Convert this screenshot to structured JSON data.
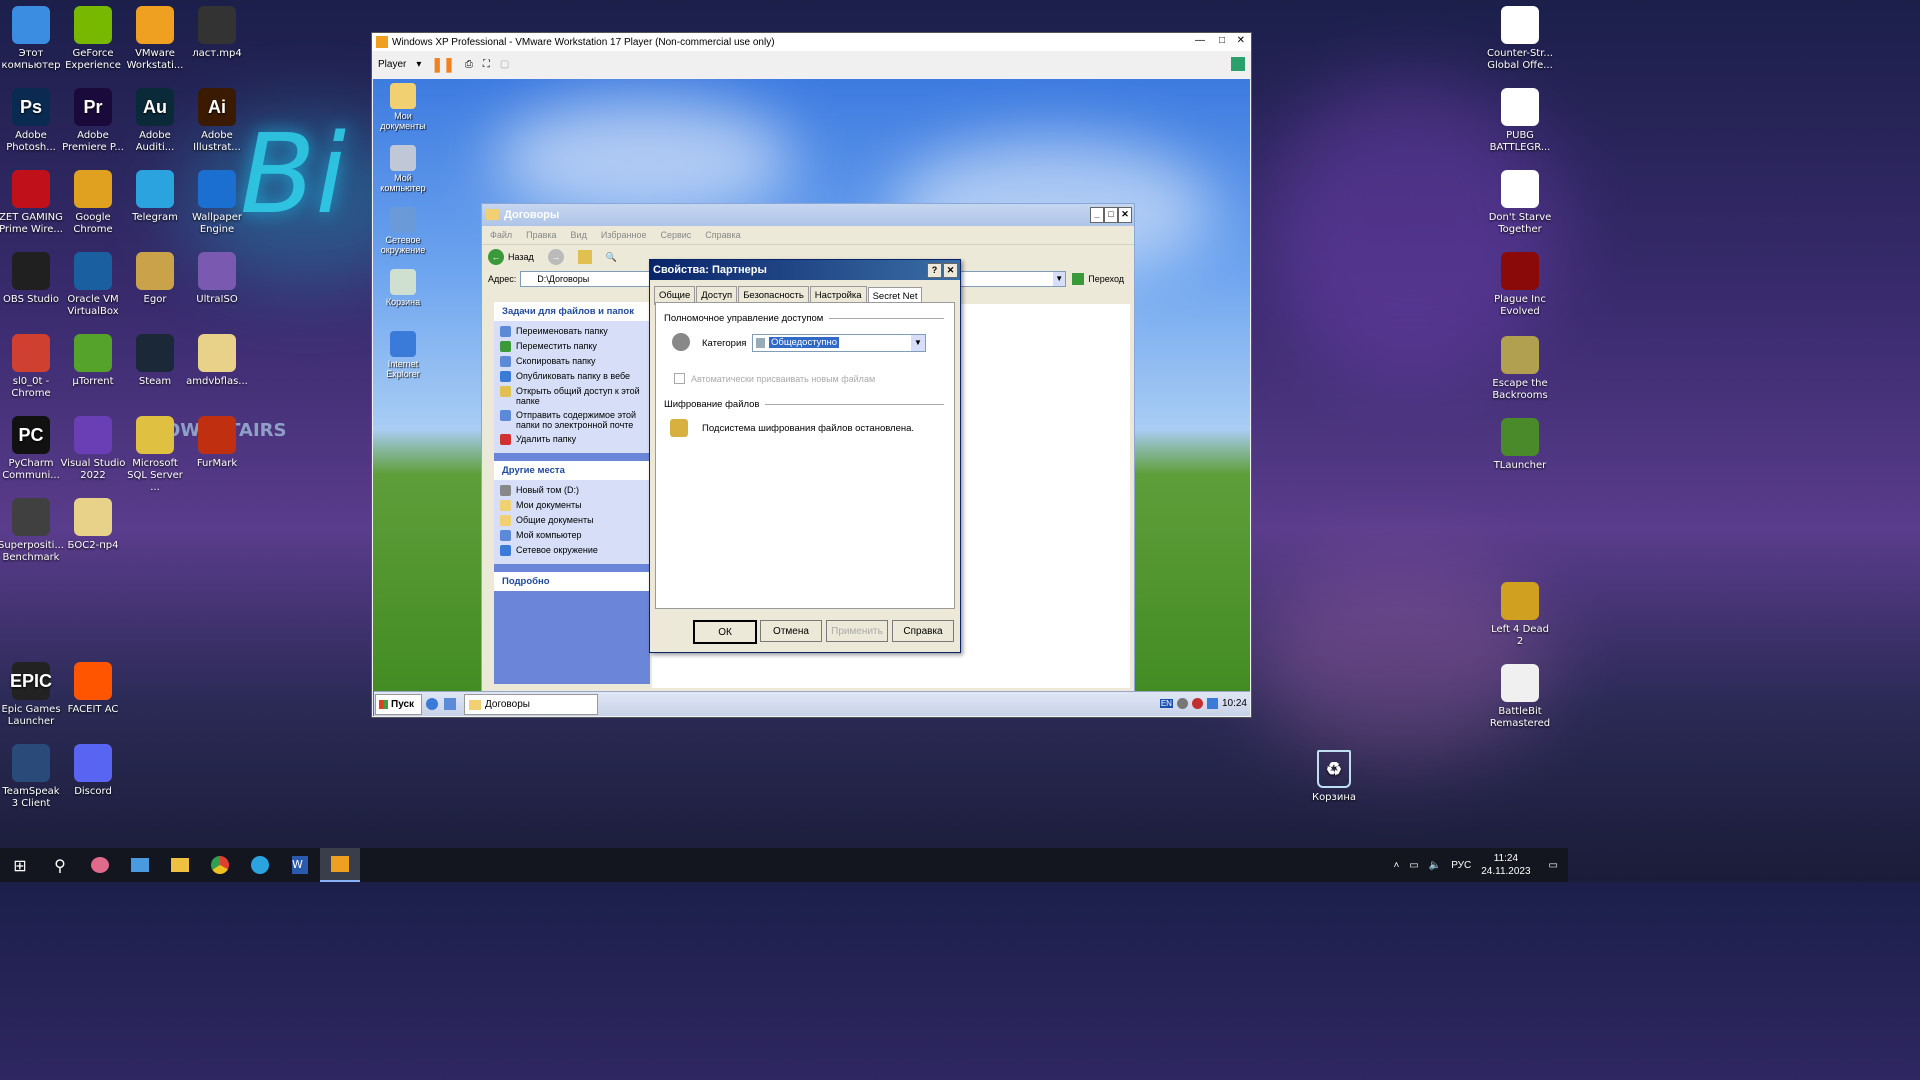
{
  "desktop_icons_left": [
    {
      "label": "Этот компьютер",
      "icon": "monitor-icon",
      "color": "#3a8de0"
    },
    {
      "label": "GeForce Experience",
      "icon": "nvidia-icon",
      "color": "#76b900"
    },
    {
      "label": "VMware Workstati...",
      "icon": "vmware-icon",
      "color": "#f0a020"
    },
    {
      "label": "ласт.mp4",
      "icon": "video-file-icon",
      "color": "#333333"
    },
    {
      "label": "Adobe Photosh...",
      "icon": "photoshop-icon",
      "color": "#0a2a52",
      "text": "Ps"
    },
    {
      "label": "Adobe Premiere P...",
      "icon": "premiere-icon",
      "color": "#1a0a3c",
      "text": "Pr"
    },
    {
      "label": "Adobe Auditi...",
      "icon": "audition-icon",
      "color": "#0a2a3a",
      "text": "Au"
    },
    {
      "label": "Adobe Illustrat...",
      "icon": "illustrator-icon",
      "color": "#3a1a00",
      "text": "Ai"
    },
    {
      "label": "ZET GAMING Prime Wire...",
      "icon": "zet-gaming-icon",
      "color": "#c0101a"
    },
    {
      "label": "Google Chrome",
      "icon": "chrome-icon",
      "color": "#e0a020"
    },
    {
      "label": "Telegram",
      "icon": "telegram-icon",
      "color": "#2aa3df"
    },
    {
      "label": "Wallpaper Engine",
      "icon": "wallpaper-engine-icon",
      "color": "#1a6fd0"
    },
    {
      "label": "OBS Studio",
      "icon": "obs-icon",
      "color": "#202020"
    },
    {
      "label": "Oracle VM VirtualBox",
      "icon": "virtualbox-icon",
      "color": "#1a5fa0"
    },
    {
      "label": "Egor",
      "icon": "folder-icon",
      "color": "#c9a24a"
    },
    {
      "label": "UltraISO",
      "icon": "ultraiso-icon",
      "color": "#7a5ab0"
    },
    {
      "label": "sl0_0t - Chrome",
      "icon": "chrome-icon",
      "color": "#d04030"
    },
    {
      "label": "µTorrent",
      "icon": "utorrent-icon",
      "color": "#55a32a"
    },
    {
      "label": "Steam",
      "icon": "steam-icon",
      "color": "#1b2838"
    },
    {
      "label": "amdvbflas...",
      "icon": "folder-icon",
      "color": "#e8d28a"
    },
    {
      "label": "PyCharm Communi...",
      "icon": "pycharm-icon",
      "color": "#111111",
      "text": "PC"
    },
    {
      "label": "Visual Studio 2022",
      "icon": "visual-studio-icon",
      "color": "#6a3fb5"
    },
    {
      "label": "Microsoft SQL Server ...",
      "icon": "sql-server-icon",
      "color": "#e0c040"
    },
    {
      "label": "FurMark",
      "icon": "furmark-icon",
      "color": "#c03010"
    },
    {
      "label": "Superpositi... Benchmark",
      "icon": "superposition-icon",
      "color": "#404040"
    },
    {
      "label": "БОС2-пр4",
      "icon": "folder-icon",
      "color": "#e8d28a"
    },
    {
      "label": "Epic Games Launcher",
      "icon": "epic-games-icon",
      "color": "#222222",
      "text": "EPIC"
    },
    {
      "label": "FACEIT AC",
      "icon": "faceit-icon",
      "color": "#ff5500"
    },
    {
      "label": "TeamSpeak 3 Client",
      "icon": "teamspeak-icon",
      "color": "#2a4a7a"
    },
    {
      "label": "Discord",
      "icon": "discord-icon",
      "color": "#5865f2"
    }
  ],
  "desktop_icons_right": [
    {
      "label": "Counter-Str... Global Offe...",
      "icon": "file-icon",
      "color": "#ffffff"
    },
    {
      "label": "PUBG BATTLEGR...",
      "icon": "file-icon",
      "color": "#ffffff"
    },
    {
      "label": "Don't Starve Together",
      "icon": "file-icon",
      "color": "#ffffff"
    },
    {
      "label": "Plague Inc Evolved",
      "icon": "plague-inc-icon",
      "color": "#8a0a0a"
    },
    {
      "label": "Escape the Backrooms",
      "icon": "backrooms-icon",
      "color": "#b0a050"
    },
    {
      "label": "TLauncher",
      "icon": "tlauncher-icon",
      "color": "#4a8a2a"
    },
    {
      "label": "Left 4 Dead 2",
      "icon": "l4d2-icon",
      "color": "#d0a020"
    },
    {
      "label": "BattleBit Remastered",
      "icon": "battlebit-icon",
      "color": "#f0f0f0"
    }
  ],
  "recycle_bin": {
    "label": "Корзина",
    "icon": "recycle-bin-icon"
  },
  "vmware": {
    "title": "Windows XP Professional - VMware Workstation 17 Player (Non-commercial use only)",
    "player_label": "Player"
  },
  "xp_desktop_icons": [
    {
      "label": "Мои документы",
      "icon": "my-documents-icon"
    },
    {
      "label": "Мой компьютер",
      "icon": "my-computer-icon"
    },
    {
      "label": "Сетевое окружение",
      "icon": "network-icon"
    },
    {
      "label": "Корзина",
      "icon": "recycle-bin-icon"
    },
    {
      "label": "Internet Explorer",
      "icon": "internet-explorer-icon"
    }
  ],
  "explorer": {
    "title": "Договоры",
    "menu": [
      "Файл",
      "Правка",
      "Вид",
      "Избранное",
      "Сервис",
      "Справка"
    ],
    "back_label": "Назад",
    "address_label": "Адрес:",
    "address_value": "D:\\Договоры",
    "go_label": "Переход",
    "tasks_header": "Задачи для файлов и папок",
    "tasks": [
      "Переименовать папку",
      "Переместить папку",
      "Скопировать папку",
      "Опубликовать папку в вебе",
      "Открыть общий доступ к этой папке",
      "Отправить содержимое этой папки по электронной почте",
      "Удалить папку"
    ],
    "places_header": "Другие места",
    "places": [
      "Новый том (D:)",
      "Мои документы",
      "Общие документы",
      "Мой компьютер",
      "Сетевое окружение"
    ],
    "details_header": "Подробно"
  },
  "dialog": {
    "title": "Свойства: Партнеры",
    "tabs": [
      "Общие",
      "Доступ",
      "Безопасность",
      "Настройка",
      "Secret Net"
    ],
    "section_access": "Полномочное управление доступом",
    "category_label": "Категория",
    "category_value": "Общедоступно",
    "auto_assign_label": "Автоматически присваивать новым файлам",
    "section_encryption": "Шифрование файлов",
    "encryption_status": "Подсистема шифрования файлов остановлена.",
    "ok": "ОК",
    "cancel": "Отмена",
    "apply": "Применить",
    "help": "Справка"
  },
  "xp_taskbar": {
    "start": "Пуск",
    "task": "Договоры",
    "clock": "10:24",
    "lang": "EN"
  },
  "win_taskbar": {
    "lang": "РУС",
    "time": "11:24",
    "date": "24.11.2023"
  }
}
